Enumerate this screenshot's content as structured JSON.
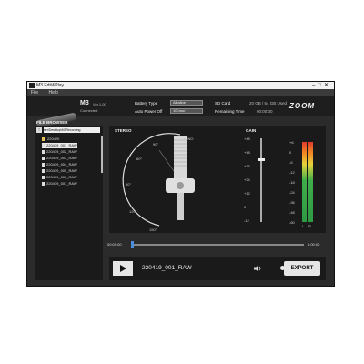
{
  "window": {
    "title": "M3 Edit&Play"
  },
  "menu": [
    "File",
    "Help"
  ],
  "device": {
    "model": "M3",
    "version": "Ver.1.00",
    "status": "Connected"
  },
  "settings": {
    "battery_label": "Battery Type",
    "battery_value": "Alkaline",
    "apo_label": "Auto Power Off",
    "apo_value": "10 hour",
    "sd_label": "SD Card",
    "sd_value": "20 GB / 64 GB Used",
    "remaining_label": "Remaining Time",
    "remaining_value": "00:00:00"
  },
  "brand": "ZOOM",
  "browser": {
    "title": "FILE BROWSER",
    "path": "ser\\Desktop\\M3Recording",
    "items": [
      {
        "name": "220420",
        "type": "folder"
      },
      {
        "name": "220419_001_RAW",
        "type": "file",
        "selected": true
      },
      {
        "name": "220419_002_RAW",
        "type": "file"
      },
      {
        "name": "220419_003_RAW",
        "type": "file"
      },
      {
        "name": "220419_004_RAW",
        "type": "file"
      },
      {
        "name": "220419_005_RAW",
        "type": "file"
      },
      {
        "name": "220419_006_RAW",
        "type": "file"
      },
      {
        "name": "220419_007_RAW",
        "type": "file"
      }
    ]
  },
  "stereo": {
    "title": "STEREO",
    "mono": "MONO",
    "angles": [
      "90°",
      "60°",
      "90°",
      "120°",
      "150°"
    ]
  },
  "gain": {
    "title": "GAIN",
    "ticks": [
      "+48",
      "+48",
      "+36",
      "+24",
      "+12",
      "0",
      "-12"
    ],
    "level": 0.76
  },
  "meter": {
    "ticks": [
      "+6",
      "0",
      "-6",
      "-12",
      "-18",
      "-24",
      "-36",
      "-48",
      "-60"
    ],
    "labels": [
      "L",
      "R"
    ]
  },
  "timeline": {
    "start": "00:00:00",
    "end": "1:00:00",
    "position": 0.0
  },
  "player": {
    "filename": "220419_001_RAW",
    "export_label": "EXPORT",
    "volume": 0.65
  }
}
